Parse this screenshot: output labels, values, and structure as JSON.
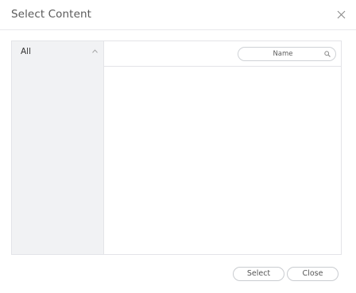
{
  "dialog": {
    "title": "Select Content",
    "close_icon": "close-icon"
  },
  "sidebar": {
    "items": [
      {
        "label": "All",
        "expanded": true,
        "icon": "chevron-up-icon"
      }
    ]
  },
  "search": {
    "placeholder": "Name",
    "value": "",
    "icon": "search-icon"
  },
  "footer": {
    "select_label": "Select",
    "close_label": "Close"
  },
  "colors": {
    "sidebar_bg": "#f1f2f4",
    "border": "#e3e4e8",
    "button_border": "#c9ccd0"
  }
}
